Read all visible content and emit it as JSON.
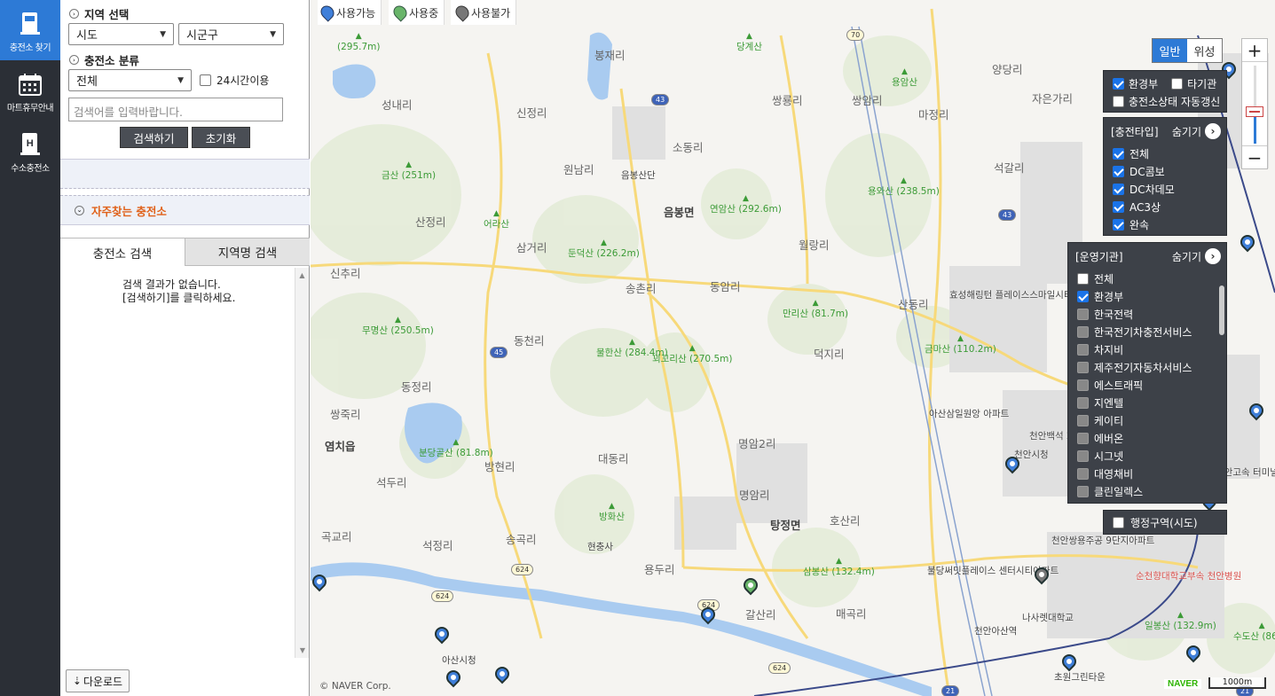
{
  "nav": [
    {
      "label": "충전소 찾기"
    },
    {
      "label": "마트휴무안내"
    },
    {
      "label": "수소충전소"
    }
  ],
  "panel": {
    "region_title": "지역 선택",
    "sido": "시도",
    "sigungu": "시군구",
    "class_title": "충전소 분류",
    "class_value": "전체",
    "hours24": "24시간이용",
    "search_placeholder": "검색어를 입력바랍니다.",
    "search_btn": "검색하기",
    "reset_btn": "초기화",
    "favorites": "자주찾는 충전소",
    "tab1": "충전소 검색",
    "tab2": "지역명 검색",
    "empty1": "검색 결과가 없습니다.",
    "empty2": "[검색하기]를 클릭하세요.",
    "download": "다운로드"
  },
  "legend": {
    "avail": "사용가능",
    "inuse": "사용중",
    "unavail": "사용불가"
  },
  "maptype": {
    "normal": "일반",
    "sat": "위성"
  },
  "org_filter": {
    "env": "환경부",
    "other": "타기관",
    "auto": "충전소상태 자동갱신"
  },
  "charger_type": {
    "title": "[충전타입]",
    "hide": "숨기기",
    "items": [
      "전체",
      "DC콤보",
      "DC차데모",
      "AC3상",
      "완속"
    ]
  },
  "operator": {
    "title": "[운영기관]",
    "hide": "숨기기",
    "items": [
      "전체",
      "환경부",
      "한국전력",
      "한국전기차충전서비스",
      "차지비",
      "제주전기자동차서비스",
      "에스트래픽",
      "지엔텔",
      "케이티",
      "에버온",
      "시그넷",
      "대영채비",
      "클린일렉스"
    ]
  },
  "admin": {
    "label": "행정구역(시도)"
  },
  "map": {
    "copyright": "© NAVER Corp.",
    "naver": "NAVER",
    "scale": "1000m",
    "places": [
      "봉재리",
      "성내리",
      "신정리",
      "원남리",
      "소동리",
      "쌍룡리",
      "쌍암리",
      "마정리",
      "양당리",
      "자은가리",
      "음봉면",
      "산정리",
      "삼거리",
      "송촌리",
      "동암리",
      "월랑리",
      "신추리",
      "동천리",
      "산동리",
      "덕지리",
      "동정리",
      "쌍죽리",
      "명암2리",
      "대동리",
      "방현리",
      "석두리",
      "명암리",
      "탕정면",
      "호산리",
      "곡교리",
      "석정리",
      "송곡리",
      "용두리",
      "갈산리",
      "매곡리",
      "석갈리",
      "염치읍"
    ],
    "mountains": [
      "금산 (251m)",
      "어라산",
      "둔덕산 (226.2m)",
      "연암산 (292.6m)",
      "용와산 (238.5m)",
      "무명산 (250.5m)",
      "물한산 (284.4m)",
      "꾀꼬리산 (270.5m)",
      "만리산 (81.7m)",
      "금마산 (110.2m)",
      "분당골산 (81.8m)",
      "방화산",
      "삼봉산 (132.4m)",
      "일봉산 (132.9m)",
      "수도산 (86m)",
      "당계산",
      "용암산",
      "(295.7m)"
    ],
    "pois": [
      "음봉산단",
      "효성해링턴 플레이스스마일시티",
      "아산삼일원앙 아파트",
      "천안시청",
      "현충사",
      "아산시청",
      "천안아산역",
      "천안쌍용주공 9단지아파트",
      "불당써밋플레이스 센터시티아파트",
      "순천향대학교부속 천안병원",
      "나사렛대학교",
      "초원그린타운",
      "천안백석 2차아파트",
      "천안고속 터미널"
    ],
    "roads": [
      "43",
      "45",
      "624",
      "624",
      "624",
      "624",
      "43",
      "21",
      "21",
      "70"
    ]
  }
}
